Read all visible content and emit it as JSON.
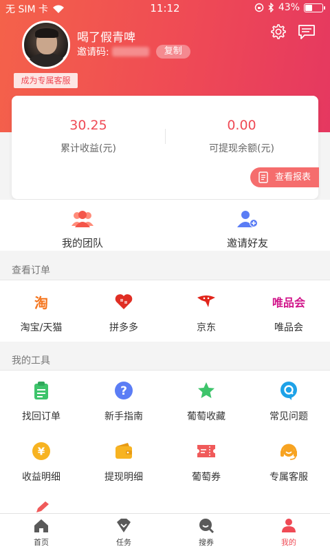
{
  "status_bar": {
    "carrier": "无 SIM 卡",
    "time": "11:12",
    "battery": "43%",
    "battery_level": 0.43
  },
  "profile": {
    "username": "喝了假青啤",
    "invite_label": "邀请码:",
    "copy_label": "复制",
    "vip_badge": "成为专属客服"
  },
  "earnings": {
    "total_value": "30.25",
    "total_label": "累计收益(元)",
    "withdrawable_value": "0.00",
    "withdrawable_label": "可提现余额(元)",
    "report_button": "查看报表"
  },
  "team": {
    "my_team": "我的团队",
    "invite_friends": "邀请好友"
  },
  "orders": {
    "title": "查看订单",
    "items": [
      {
        "label": "淘宝/天猫",
        "icon": "taobao-icon",
        "glyph": "淘",
        "color": "#f5761f"
      },
      {
        "label": "拼多多",
        "icon": "pinduoduo-icon",
        "color": "#e02e24"
      },
      {
        "label": "京东",
        "icon": "jingdong-icon",
        "color": "#e1251b"
      },
      {
        "label": "唯品会",
        "icon": "vipshop-icon",
        "glyph": "唯品会",
        "color": "#d1158a"
      }
    ]
  },
  "tools": {
    "title": "我的工具",
    "items": [
      {
        "label": "找回订单",
        "icon": "clipboard-icon",
        "color": "#3ec46b"
      },
      {
        "label": "新手指南",
        "icon": "question-icon",
        "color": "#5b7df5"
      },
      {
        "label": "葡萄收藏",
        "icon": "star-icon",
        "color": "#3ec46b"
      },
      {
        "label": "常见问题",
        "icon": "q-bubble-icon",
        "color": "#1ea2e8"
      },
      {
        "label": "收益明细",
        "icon": "yen-coin-icon",
        "color": "#f7b321"
      },
      {
        "label": "提现明细",
        "icon": "wallet-icon",
        "color": "#f7b321"
      },
      {
        "label": "葡萄券",
        "icon": "ticket-icon",
        "color": "#f05a5a"
      },
      {
        "label": "专属客服",
        "icon": "headset-icon",
        "color": "#f7a321"
      }
    ]
  },
  "tabbar": [
    {
      "label": "首页",
      "icon": "home-icon"
    },
    {
      "label": "任务",
      "icon": "task-icon"
    },
    {
      "label": "搜券",
      "icon": "search-coupon-icon"
    },
    {
      "label": "我的",
      "icon": "profile-icon",
      "active": true
    }
  ],
  "colors": {
    "accent": "#ef4a55",
    "header_start": "#f4624a",
    "header_end": "#e53860"
  }
}
